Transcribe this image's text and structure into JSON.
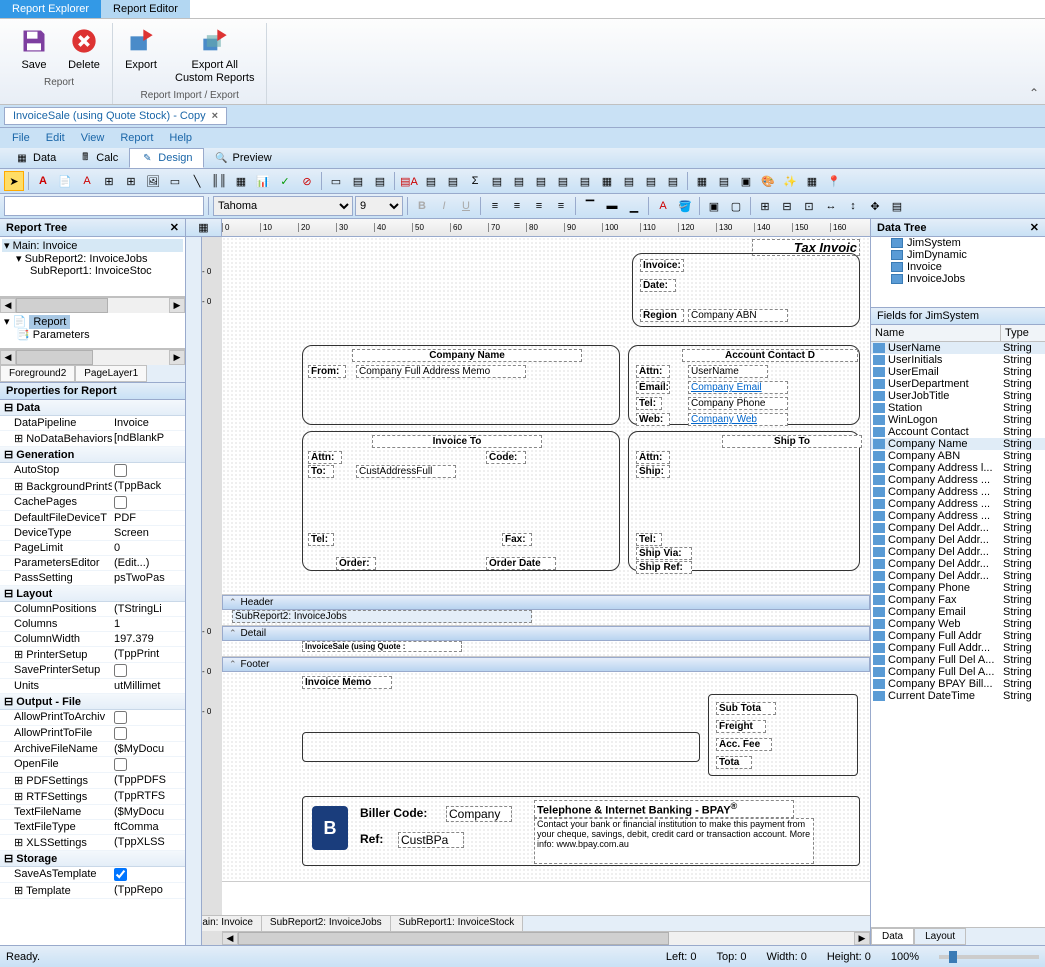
{
  "top_tabs": {
    "explorer": "Report Explorer",
    "editor": "Report Editor"
  },
  "ribbon": {
    "save": "Save",
    "delete": "Delete",
    "export": "Export",
    "export_all_line1": "Export All",
    "export_all_line2": "Custom Reports",
    "group_report": "Report",
    "group_import_export": "Report Import / Export"
  },
  "doc_tab": "InvoiceSale (using Quote Stock) - Copy",
  "menu": {
    "file": "File",
    "edit": "Edit",
    "view": "View",
    "report": "Report",
    "help": "Help"
  },
  "view_tabs": {
    "data": "Data",
    "calc": "Calc",
    "design": "Design",
    "preview": "Preview"
  },
  "font_toolbar": {
    "font": "Tahoma",
    "size": "9"
  },
  "report_tree": {
    "title": "Report Tree",
    "main": "Main: Invoice",
    "sub2": "SubReport2: InvoiceJobs",
    "sub1": "SubReport1: InvoiceStoc",
    "report_node": "Report",
    "params": "Parameters",
    "layer_tabs": {
      "fg2": "Foreground2",
      "pl1": "PageLayer1"
    }
  },
  "props": {
    "title": "Properties for Report",
    "cat_data": "Data",
    "DataPipeline": [
      "DataPipeline",
      "Invoice"
    ],
    "NoDataBehaviors": [
      "NoDataBehaviors",
      "[ndBlankP"
    ],
    "cat_gen": "Generation",
    "AutoStop": [
      "AutoStop",
      ""
    ],
    "BackgroundPrintSe": [
      "BackgroundPrintSe",
      "(TppBack"
    ],
    "CachePages": [
      "CachePages",
      ""
    ],
    "DefaultFileDeviceT": [
      "DefaultFileDeviceT",
      "PDF"
    ],
    "DeviceType": [
      "DeviceType",
      "Screen"
    ],
    "PageLimit": [
      "PageLimit",
      "0"
    ],
    "ParametersEditor": [
      "ParametersEditor",
      "(Edit...)"
    ],
    "PassSetting": [
      "PassSetting",
      "psTwoPas"
    ],
    "cat_layout": "Layout",
    "ColumnPositions": [
      "ColumnPositions",
      "(TStringLi"
    ],
    "Columns": [
      "Columns",
      "1"
    ],
    "ColumnWidth": [
      "ColumnWidth",
      "197.379"
    ],
    "PrinterSetup": [
      "PrinterSetup",
      "(TppPrint"
    ],
    "SavePrinterSetup": [
      "SavePrinterSetup",
      ""
    ],
    "Units": [
      "Units",
      "utMillimet"
    ],
    "cat_output": "Output - File",
    "AllowPrintToArchiv": [
      "AllowPrintToArchiv",
      ""
    ],
    "AllowPrintToFile": [
      "AllowPrintToFile",
      ""
    ],
    "ArchiveFileName": [
      "ArchiveFileName",
      "($MyDocu"
    ],
    "OpenFile": [
      "OpenFile",
      ""
    ],
    "PDFSettings": [
      "PDFSettings",
      "(TppPDFS"
    ],
    "RTFSettings": [
      "RTFSettings",
      "(TppRTFS"
    ],
    "TextFileName": [
      "TextFileName",
      "($MyDocu"
    ],
    "TextFileType": [
      "TextFileType",
      "ftComma"
    ],
    "XLSSettings": [
      "XLSSettings",
      "(TppXLSS"
    ],
    "cat_storage": "Storage",
    "SaveAsTemplate": [
      "SaveAsTemplate",
      ""
    ],
    "Template": [
      "Template",
      "(TppRepo"
    ]
  },
  "canvas": {
    "band_header": "Header",
    "band_detail": "Detail",
    "band_footer": "Footer",
    "subreport2_label": "SubReport2: InvoiceJobs",
    "invoice_sale_label": "InvoiceSale (using Quote :",
    "tax_invoice": "Tax Invoic",
    "invoice_lbl": "Invoice:",
    "date_lbl": "Date:",
    "region_lbl": "Region",
    "company_abn": "Company ABN",
    "company_name_hdr": "Company Name",
    "from_lbl": "From:",
    "company_full_addr": "Company Full Address Memo",
    "account_contact_hdr": "Account Contact D",
    "attn_lbl": "Attn:",
    "username_val": "UserName",
    "email_lbl": "Email:",
    "company_email": "Company Email",
    "tel_lbl": "Tel:",
    "company_phone": "Company Phone",
    "web_lbl": "Web:",
    "company_web": "Company Web",
    "invoice_to_hdr": "Invoice To",
    "code_lbl": "Code:",
    "to_lbl": "To:",
    "cust_addr": "CustAddressFull",
    "fax_lbl": "Fax:",
    "order_lbl": "Order:",
    "order_date_lbl": "Order Date",
    "ship_to_hdr": "Ship To",
    "ship_lbl": "Ship:",
    "ship_via_lbl": "Ship Via:",
    "ship_ref_lbl": "Ship Ref:",
    "invoice_memo": "Invoice Memo",
    "subtotal": "Sub Tota",
    "freight": "Freight",
    "accfee": "Acc. Fee",
    "total": "Tota",
    "biller_code": "Biller Code:",
    "company_pref": "Company",
    "ref_lbl": "Ref:",
    "custbpa": "CustBPa",
    "bpay_hdr": "Telephone & Internet Banking - BPAY",
    "bpay_text": "Contact your bank or financial institution to make this payment from your cheque, savings, debit, credit card or transaction account. More info: www.bpay.com.au",
    "bottom_tabs": {
      "main": "Main: Invoice",
      "sub2": "SubReport2: InvoiceJobs",
      "sub1": "SubReport1: InvoiceStock"
    }
  },
  "data_tree": {
    "title": "Data Tree",
    "nodes": [
      "JimSystem",
      "JimDynamic",
      "Invoice",
      "InvoiceJobs"
    ],
    "fields_header": "Fields for JimSystem",
    "col_name": "Name",
    "col_type": "Type",
    "fields": [
      [
        "UserName",
        "String"
      ],
      [
        "UserInitials",
        "String"
      ],
      [
        "UserEmail",
        "String"
      ],
      [
        "UserDepartment",
        "String"
      ],
      [
        "UserJobTitle",
        "String"
      ],
      [
        "Station",
        "String"
      ],
      [
        "WinLogon",
        "String"
      ],
      [
        "Account Contact",
        "String"
      ],
      [
        "Company Name",
        "String"
      ],
      [
        "Company ABN",
        "String"
      ],
      [
        "Company Address l...",
        "String"
      ],
      [
        "Company Address ...",
        "String"
      ],
      [
        "Company Address ...",
        "String"
      ],
      [
        "Company Address ...",
        "String"
      ],
      [
        "Company Address ...",
        "String"
      ],
      [
        "Company Del Addr...",
        "String"
      ],
      [
        "Company Del Addr...",
        "String"
      ],
      [
        "Company Del Addr...",
        "String"
      ],
      [
        "Company Del Addr...",
        "String"
      ],
      [
        "Company Del Addr...",
        "String"
      ],
      [
        "Company Phone",
        "String"
      ],
      [
        "Company Fax",
        "String"
      ],
      [
        "Company Email",
        "String"
      ],
      [
        "Company Web",
        "String"
      ],
      [
        "Company Full Addr",
        "String"
      ],
      [
        "Company Full Addr...",
        "String"
      ],
      [
        "Company Full Del A...",
        "String"
      ],
      [
        "Company Full Del A...",
        "String"
      ],
      [
        "Company BPAY Bill...",
        "String"
      ],
      [
        "Current DateTime",
        "String"
      ]
    ],
    "bottom_tabs": {
      "data": "Data",
      "layout": "Layout"
    }
  },
  "status": {
    "ready": "Ready.",
    "left": "Left: 0",
    "top": "Top: 0",
    "width": "Width: 0",
    "height": "Height: 0",
    "zoom": "100%"
  }
}
